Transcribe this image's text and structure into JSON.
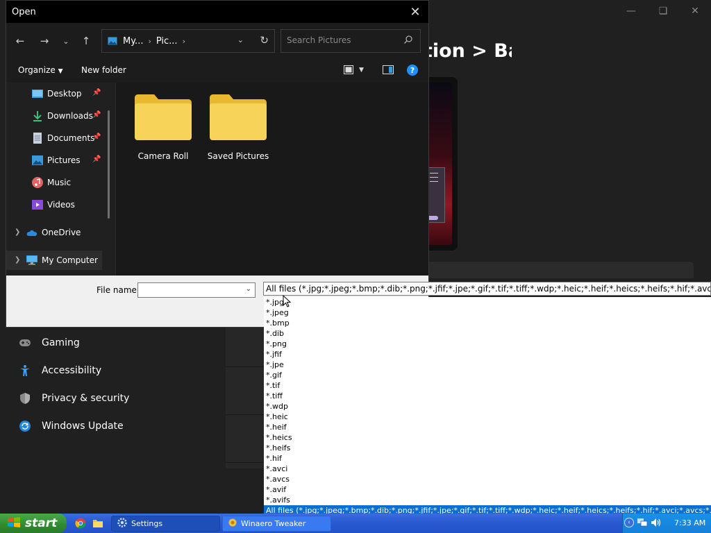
{
  "settings": {
    "page_heading": "Personalization > Background",
    "nav_items": [
      {
        "label": "Gaming"
      },
      {
        "label": "Accessibility"
      },
      {
        "label": "Privacy & security"
      },
      {
        "label": "Windows Update"
      }
    ]
  },
  "dialog": {
    "title": "Open",
    "breadcrumbs": [
      "My...",
      "Pic..."
    ],
    "search_placeholder": "Search Pictures",
    "toolbar": {
      "organize": "Organize",
      "new_folder": "New folder"
    },
    "sidebar": [
      {
        "label": "Desktop"
      },
      {
        "label": "Downloads"
      },
      {
        "label": "Documents"
      },
      {
        "label": "Pictures"
      },
      {
        "label": "Music"
      },
      {
        "label": "Videos"
      },
      {
        "label": "OneDrive"
      },
      {
        "label": "My Computer"
      }
    ],
    "folders": [
      {
        "label": "Camera Roll"
      },
      {
        "label": "Saved Pictures"
      }
    ],
    "file_name_label": "File name:",
    "file_name_value": ""
  },
  "filter": {
    "selected": "All files (*.jpg;*.jpeg;*.bmp;*.dib;*.png;*.jfif;*.jpe;*.gif;*.tif;*.tiff;*.wdp;*.heic;*.heif;*.heics;*.heifs;*.hif;*.avci;*.avcs;*.avif;*.avifs)",
    "options": [
      "*.jpg",
      "*.jpeg",
      "*.bmp",
      "*.dib",
      "*.png",
      "*.jfif",
      "*.jpe",
      "*.gif",
      "*.tif",
      "*.tiff",
      "*.wdp",
      "*.heic",
      "*.heif",
      "*.heics",
      "*.heifs",
      "*.hif",
      "*.avci",
      "*.avcs",
      "*.avif",
      "*.avifs"
    ],
    "highlighted": "All files (*.jpg;*.jpeg;*.bmp;*.dib;*.png;*.jfif;*.jpe;*.gif;*.tif;*.tiff;*.wdp;*.heic;*.heif;*.heics;*.heifs;*.hif;*.avci;*.avcs;*.avif;*.avifs)"
  },
  "taskbar": {
    "start_label": "start",
    "tasks": [
      {
        "label": "Settings"
      },
      {
        "label": "Winaero Tweaker"
      }
    ],
    "clock": "7:33 AM"
  }
}
